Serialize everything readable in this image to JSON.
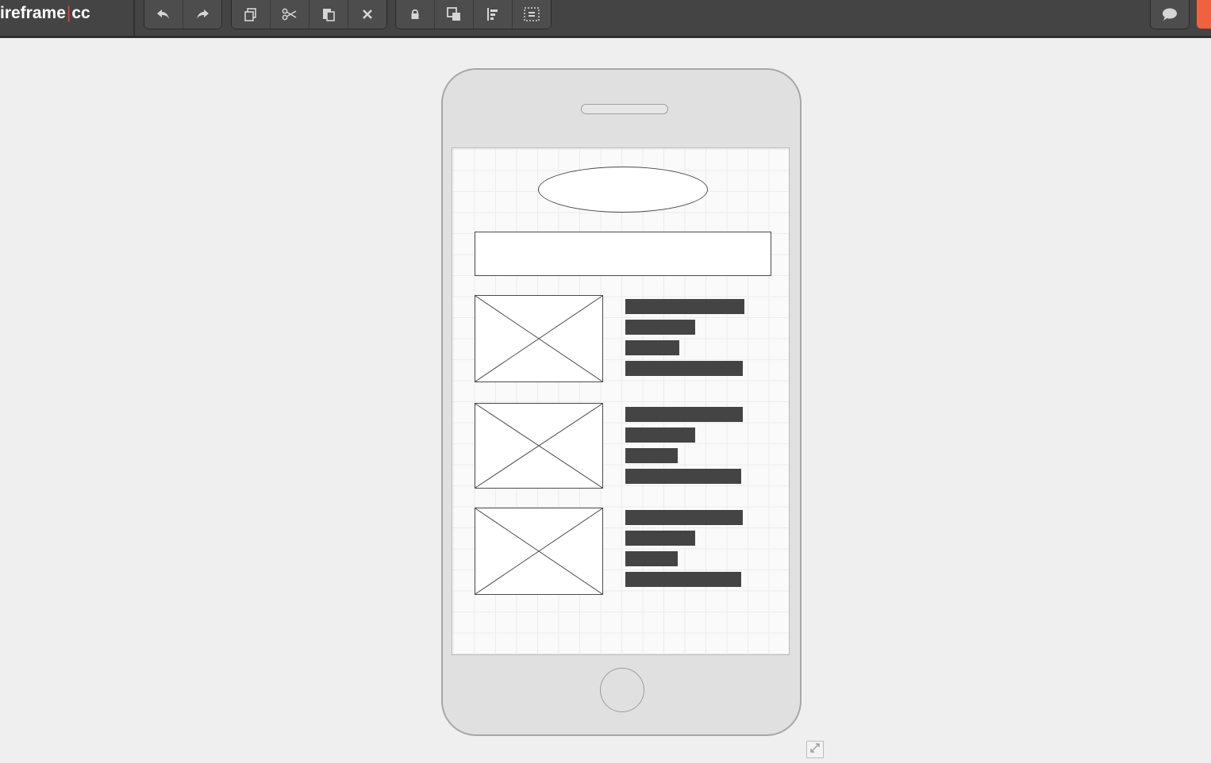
{
  "app": {
    "logo_main": "ireframe",
    "logo_separator": "|",
    "logo_suffix": "cc"
  },
  "toolbar": {
    "groups": [
      {
        "name": "history",
        "buttons": [
          "undo-icon",
          "redo-icon"
        ]
      },
      {
        "name": "clipboard",
        "buttons": [
          "duplicate-icon",
          "cut-icon",
          "paste-icon",
          "delete-icon"
        ]
      },
      {
        "name": "arrange",
        "buttons": [
          "lock-icon",
          "layer-order-icon",
          "align-icon",
          "group-select-icon"
        ]
      },
      {
        "name": "comments",
        "buttons": [
          "comment-icon"
        ]
      }
    ],
    "colors": {
      "bar": "#444444",
      "accent": "#f0613f",
      "logo_separator": "#e2403a"
    }
  },
  "canvas": {
    "device": "iphone",
    "wireframe": {
      "header_shape": "oval",
      "search_box": "rectangle",
      "list_items": [
        {
          "image": "image-placeholder",
          "text_lines": 4
        },
        {
          "image": "image-placeholder",
          "text_lines": 4
        },
        {
          "image": "image-placeholder",
          "text_lines": 4
        }
      ]
    }
  }
}
